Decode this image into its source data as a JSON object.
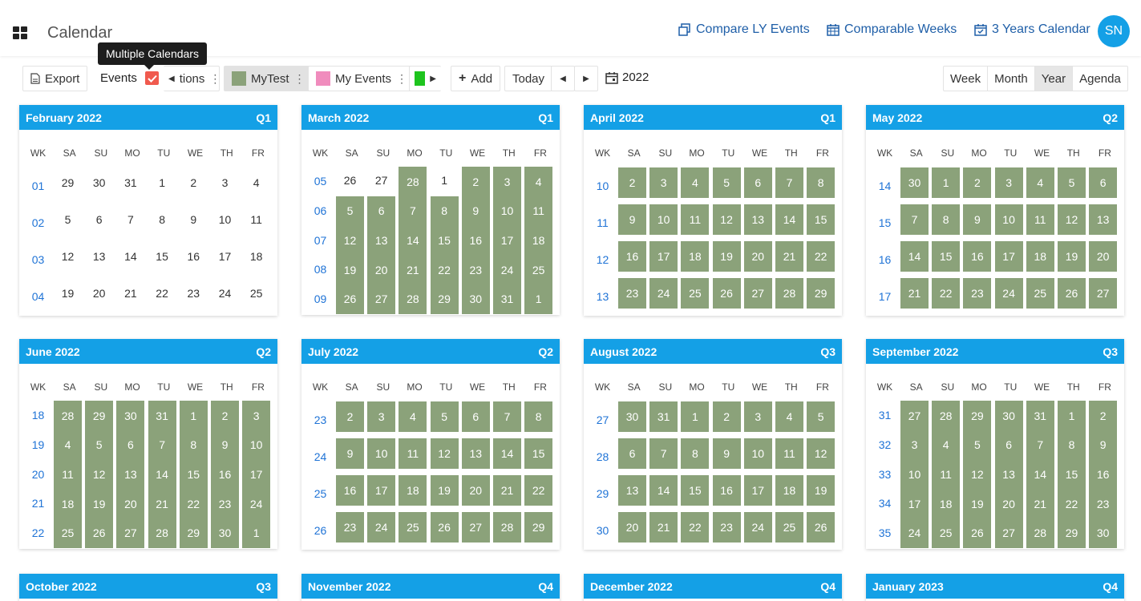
{
  "app": {
    "title": "Calendar",
    "avatar": "SN"
  },
  "header_links": [
    {
      "label": "Compare LY Events",
      "icon": "copy-calendar-icon"
    },
    {
      "label": "Comparable Weeks",
      "icon": "calendar-grid-icon"
    },
    {
      "label": "3 Years Calendar",
      "icon": "calendar-check-icon"
    }
  ],
  "toolbar": {
    "export": "Export",
    "events": "Events",
    "tooltip": "Multiple Calendars",
    "partial_item": "tions",
    "calendars": [
      {
        "label": "MyTest",
        "color": "#8ba27a"
      },
      {
        "label": "My Events",
        "color": "#f08cbd"
      },
      {
        "label": "",
        "color": "#1ec41e"
      }
    ],
    "add": "Add",
    "today": "Today",
    "year": "2022",
    "views": [
      "Week",
      "Month",
      "Year",
      "Agenda"
    ],
    "active_view": "Year"
  },
  "colors": {
    "accent": "#14a0e6",
    "highlight": "#8ba27a",
    "check": "#f05a4e"
  },
  "day_headers": [
    "WK",
    "SA",
    "SU",
    "MO",
    "TU",
    "WE",
    "TH",
    "FR"
  ],
  "months": [
    {
      "title": "February 2022",
      "quarter": "Q1",
      "rows": [
        {
          "wk": "01",
          "days": [
            "29",
            "30",
            "31",
            "1",
            "2",
            "3",
            "4"
          ]
        },
        {
          "wk": "02",
          "days": [
            "5",
            "6",
            "7",
            "8",
            "9",
            "10",
            "11"
          ]
        },
        {
          "wk": "03",
          "days": [
            "12",
            "13",
            "14",
            "15",
            "16",
            "17",
            "18"
          ]
        },
        {
          "wk": "04",
          "days": [
            "19",
            "20",
            "21",
            "22",
            "23",
            "24",
            "25"
          ]
        }
      ]
    },
    {
      "title": "March 2022",
      "quarter": "Q1",
      "rows": [
        {
          "wk": "05",
          "days": [
            "26",
            "27",
            "28",
            "1",
            "2",
            "3",
            "4"
          ]
        },
        {
          "wk": "06",
          "days": [
            "5",
            "6",
            "7",
            "8",
            "9",
            "10",
            "11"
          ]
        },
        {
          "wk": "07",
          "days": [
            "12",
            "13",
            "14",
            "15",
            "16",
            "17",
            "18"
          ]
        },
        {
          "wk": "08",
          "days": [
            "19",
            "20",
            "21",
            "22",
            "23",
            "24",
            "25"
          ]
        },
        {
          "wk": "09",
          "days": [
            "26",
            "27",
            "28",
            "29",
            "30",
            "31",
            "1"
          ]
        }
      ]
    },
    {
      "title": "April 2022",
      "quarter": "Q1",
      "rows": [
        {
          "wk": "10",
          "days": [
            "2",
            "3",
            "4",
            "5",
            "6",
            "7",
            "8"
          ]
        },
        {
          "wk": "11",
          "days": [
            "9",
            "10",
            "11",
            "12",
            "13",
            "14",
            "15"
          ]
        },
        {
          "wk": "12",
          "days": [
            "16",
            "17",
            "18",
            "19",
            "20",
            "21",
            "22"
          ]
        },
        {
          "wk": "13",
          "days": [
            "23",
            "24",
            "25",
            "26",
            "27",
            "28",
            "29"
          ]
        }
      ]
    },
    {
      "title": "May 2022",
      "quarter": "Q2",
      "rows": [
        {
          "wk": "14",
          "days": [
            "30",
            "1",
            "2",
            "3",
            "4",
            "5",
            "6"
          ]
        },
        {
          "wk": "15",
          "days": [
            "7",
            "8",
            "9",
            "10",
            "11",
            "12",
            "13"
          ]
        },
        {
          "wk": "16",
          "days": [
            "14",
            "15",
            "16",
            "17",
            "18",
            "19",
            "20"
          ]
        },
        {
          "wk": "17",
          "days": [
            "21",
            "22",
            "23",
            "24",
            "25",
            "26",
            "27"
          ]
        }
      ]
    },
    {
      "title": "June 2022",
      "quarter": "Q2",
      "rows": [
        {
          "wk": "18",
          "days": [
            "28",
            "29",
            "30",
            "31",
            "1",
            "2",
            "3"
          ]
        },
        {
          "wk": "19",
          "days": [
            "4",
            "5",
            "6",
            "7",
            "8",
            "9",
            "10"
          ]
        },
        {
          "wk": "20",
          "days": [
            "11",
            "12",
            "13",
            "14",
            "15",
            "16",
            "17"
          ]
        },
        {
          "wk": "21",
          "days": [
            "18",
            "19",
            "20",
            "21",
            "22",
            "23",
            "24"
          ]
        },
        {
          "wk": "22",
          "days": [
            "25",
            "26",
            "27",
            "28",
            "29",
            "30",
            "1"
          ]
        }
      ]
    },
    {
      "title": "July 2022",
      "quarter": "Q2",
      "rows": [
        {
          "wk": "23",
          "days": [
            "2",
            "3",
            "4",
            "5",
            "6",
            "7",
            "8"
          ]
        },
        {
          "wk": "24",
          "days": [
            "9",
            "10",
            "11",
            "12",
            "13",
            "14",
            "15"
          ]
        },
        {
          "wk": "25",
          "days": [
            "16",
            "17",
            "18",
            "19",
            "20",
            "21",
            "22"
          ]
        },
        {
          "wk": "26",
          "days": [
            "23",
            "24",
            "25",
            "26",
            "27",
            "28",
            "29"
          ]
        }
      ]
    },
    {
      "title": "August 2022",
      "quarter": "Q3",
      "rows": [
        {
          "wk": "27",
          "days": [
            "30",
            "31",
            "1",
            "2",
            "3",
            "4",
            "5"
          ]
        },
        {
          "wk": "28",
          "days": [
            "6",
            "7",
            "8",
            "9",
            "10",
            "11",
            "12"
          ]
        },
        {
          "wk": "29",
          "days": [
            "13",
            "14",
            "15",
            "16",
            "17",
            "18",
            "19"
          ]
        },
        {
          "wk": "30",
          "days": [
            "20",
            "21",
            "22",
            "23",
            "24",
            "25",
            "26"
          ]
        }
      ]
    },
    {
      "title": "September 2022",
      "quarter": "Q3",
      "rows": [
        {
          "wk": "31",
          "days": [
            "27",
            "28",
            "29",
            "30",
            "31",
            "1",
            "2"
          ]
        },
        {
          "wk": "32",
          "days": [
            "3",
            "4",
            "5",
            "6",
            "7",
            "8",
            "9"
          ]
        },
        {
          "wk": "33",
          "days": [
            "10",
            "11",
            "12",
            "13",
            "14",
            "15",
            "16"
          ]
        },
        {
          "wk": "34",
          "days": [
            "17",
            "18",
            "19",
            "20",
            "21",
            "22",
            "23"
          ]
        },
        {
          "wk": "35",
          "days": [
            "24",
            "25",
            "26",
            "27",
            "28",
            "29",
            "30"
          ]
        }
      ]
    },
    {
      "title": "October 2022",
      "quarter": "Q3",
      "rows": []
    },
    {
      "title": "November 2022",
      "quarter": "Q4",
      "rows": []
    },
    {
      "title": "December 2022",
      "quarter": "Q4",
      "rows": []
    },
    {
      "title": "January 2023",
      "quarter": "Q4",
      "rows": []
    }
  ]
}
